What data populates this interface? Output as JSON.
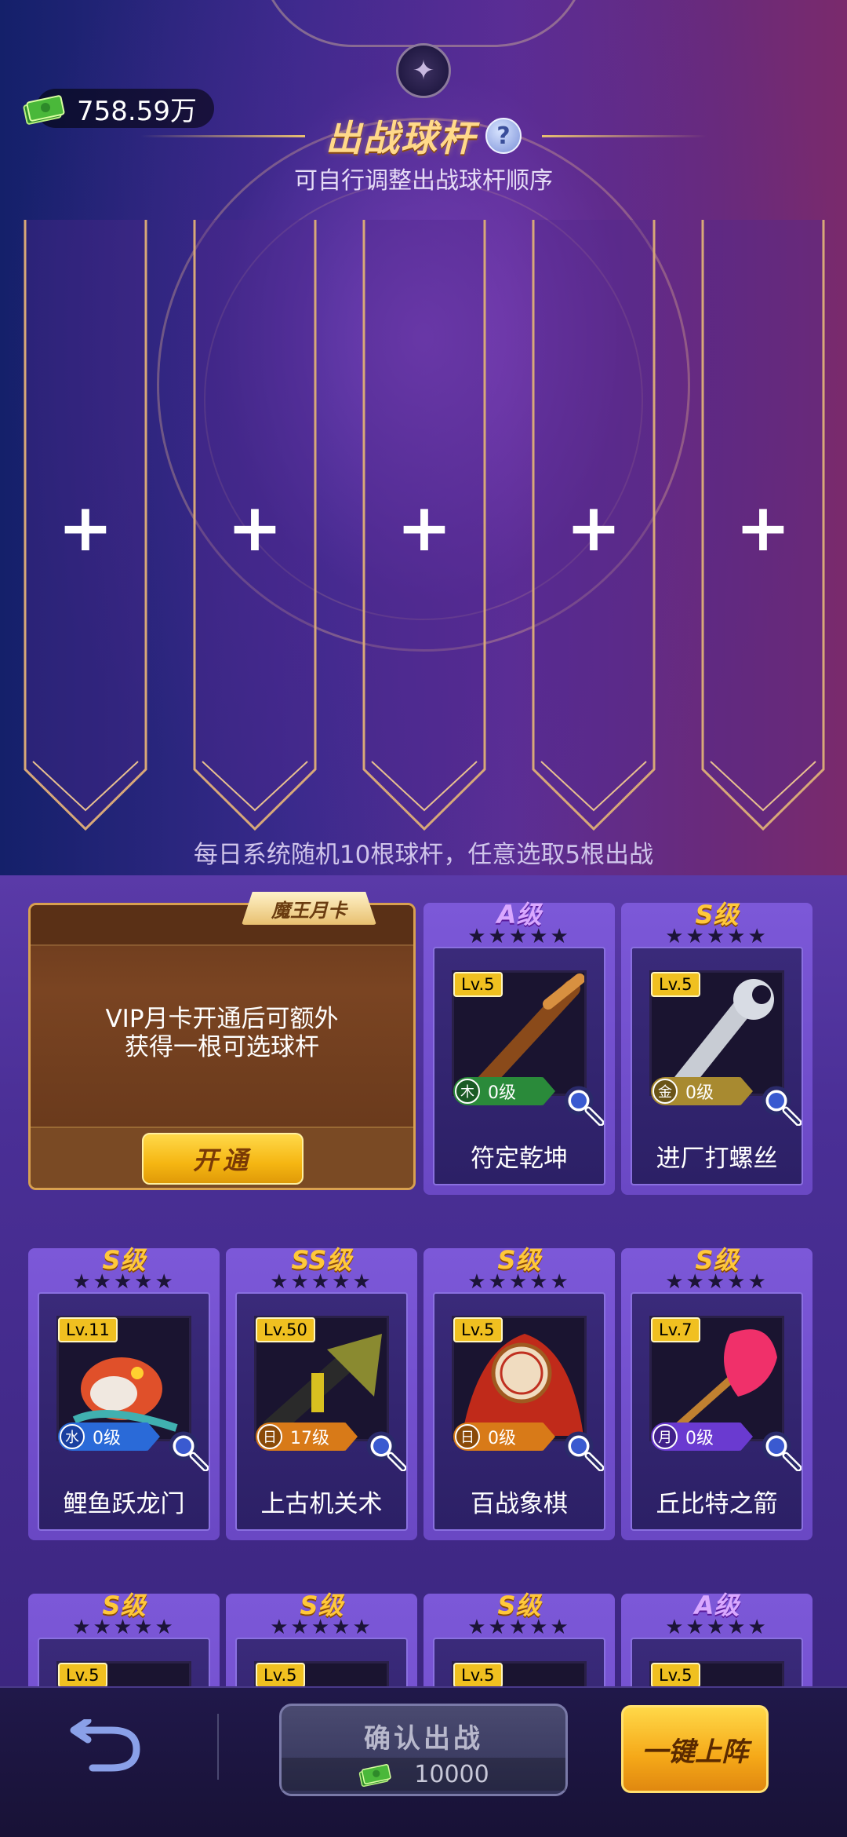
{
  "currency": {
    "amount": "758.59万",
    "icon": "cash-icon"
  },
  "header": {
    "title": "出战球杆",
    "subtitle": "可自行调整出战球杆顺序",
    "help_icon": "?"
  },
  "slots": [
    {
      "symbol": "+"
    },
    {
      "symbol": "+"
    },
    {
      "symbol": "+"
    },
    {
      "symbol": "+"
    },
    {
      "symbol": "+"
    }
  ],
  "hint": "每日系统随机10根球杆，任意选取5根出战",
  "vip": {
    "tag": "魔王月卡",
    "text_line1": "VIP月卡开通后可额外",
    "text_line2": "获得一根可选球杆",
    "button": "开通"
  },
  "cards": [
    {
      "grade": "A级",
      "stars": "★★★★★",
      "lv": "Lv.5",
      "element": "木",
      "level": "0级",
      "name": "符定乾坤"
    },
    {
      "grade": "S级",
      "stars": "★★★★★",
      "lv": "Lv.5",
      "element": "金",
      "level": "0级",
      "name": "进厂打螺丝"
    },
    {
      "grade": "S级",
      "stars": "★★★★★",
      "lv": "Lv.11",
      "element": "水",
      "level": "0级",
      "name": "鲤鱼跃龙门"
    },
    {
      "grade": "SS级",
      "stars": "★★★★★",
      "lv": "Lv.50",
      "element": "日",
      "level": "17级",
      "name": "上古机关术"
    },
    {
      "grade": "S级",
      "stars": "★★★★★",
      "lv": "Lv.5",
      "element": "日",
      "level": "0级",
      "name": "百战象棋"
    },
    {
      "grade": "S级",
      "stars": "★★★★★",
      "lv": "Lv.7",
      "element": "月",
      "level": "0级",
      "name": "丘比特之箭"
    },
    {
      "grade": "S级",
      "stars": "★★★★★",
      "lv": "Lv.5"
    },
    {
      "grade": "S级",
      "stars": "★★★★★",
      "lv": "Lv.5"
    },
    {
      "grade": "S级",
      "stars": "★★★★★",
      "lv": "Lv.5"
    },
    {
      "grade": "A级",
      "stars": "★★★★★",
      "lv": "Lv.5"
    }
  ],
  "bottom": {
    "confirm_label": "确认出战",
    "cost": "10000",
    "auto_label": "一键上阵"
  },
  "colors": {
    "wood": "#2a8a3a",
    "metal": "#a88a30",
    "water": "#2a6ad8",
    "sun": "#d87a18",
    "moon": "#6a3ad0"
  }
}
